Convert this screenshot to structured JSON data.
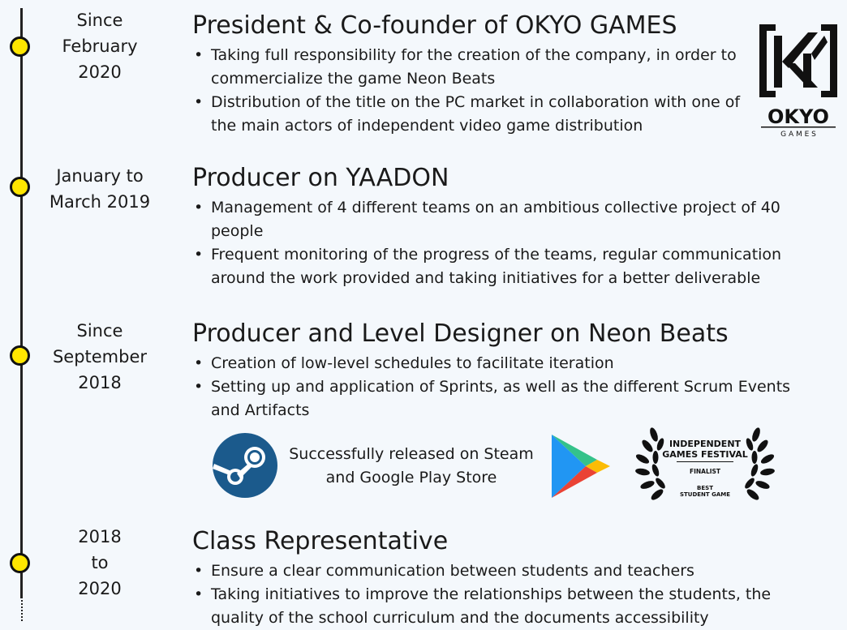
{
  "timeline": [
    {
      "date": "Since\nFebruary\n2020",
      "title": "President & Co-founder of OKYO GAMES",
      "bullets": [
        "Taking full responsibility for the creation of the company, in order to commercialize the game Neon Beats",
        "Distribution of the title on the PC market in collaboration with one of the main actors of independent video game distribution"
      ]
    },
    {
      "date": "January to\nMarch 2019",
      "title": "Producer on YAADON",
      "bullets": [
        "Management of 4 different teams on an ambitious collective project of 40 people",
        "Frequent monitoring of the progress of the teams, regular communication around the work provided and taking initiatives for a better deliverable"
      ]
    },
    {
      "date": "Since\nSeptember\n2018",
      "title": "Producer and Level Designer on Neon Beats",
      "bullets": [
        "Creation of low-level schedules to facilitate iteration",
        "Setting up and application of Sprints, as well as the different Scrum Events and Artifacts"
      ]
    },
    {
      "date": "2018\nto\n2020",
      "title": "Class Representative",
      "bullets": [
        "Ensure a clear communication between students and teachers",
        "Taking initiatives to improve the relationships between the students, the quality of the school curriculum and the documents accessibility"
      ]
    }
  ],
  "okyo_logo": {
    "name": "OKYO",
    "tagline": "G A M E S"
  },
  "release_text": "Successfully released on Steam\nand Google Play Store",
  "festival_badge": {
    "line1": "INDEPENDENT",
    "line2": "GAMES FESTIVAL",
    "line3": "FINALIST",
    "line4": "BEST",
    "line5": "STUDENT GAME"
  },
  "colors": {
    "dot_fill": "#ffe600",
    "background": "#f4f8fc",
    "steam_blue": "#1b5a8c"
  },
  "icons": [
    "steam-icon",
    "google-play-icon",
    "laurel-wreath-icon"
  ]
}
